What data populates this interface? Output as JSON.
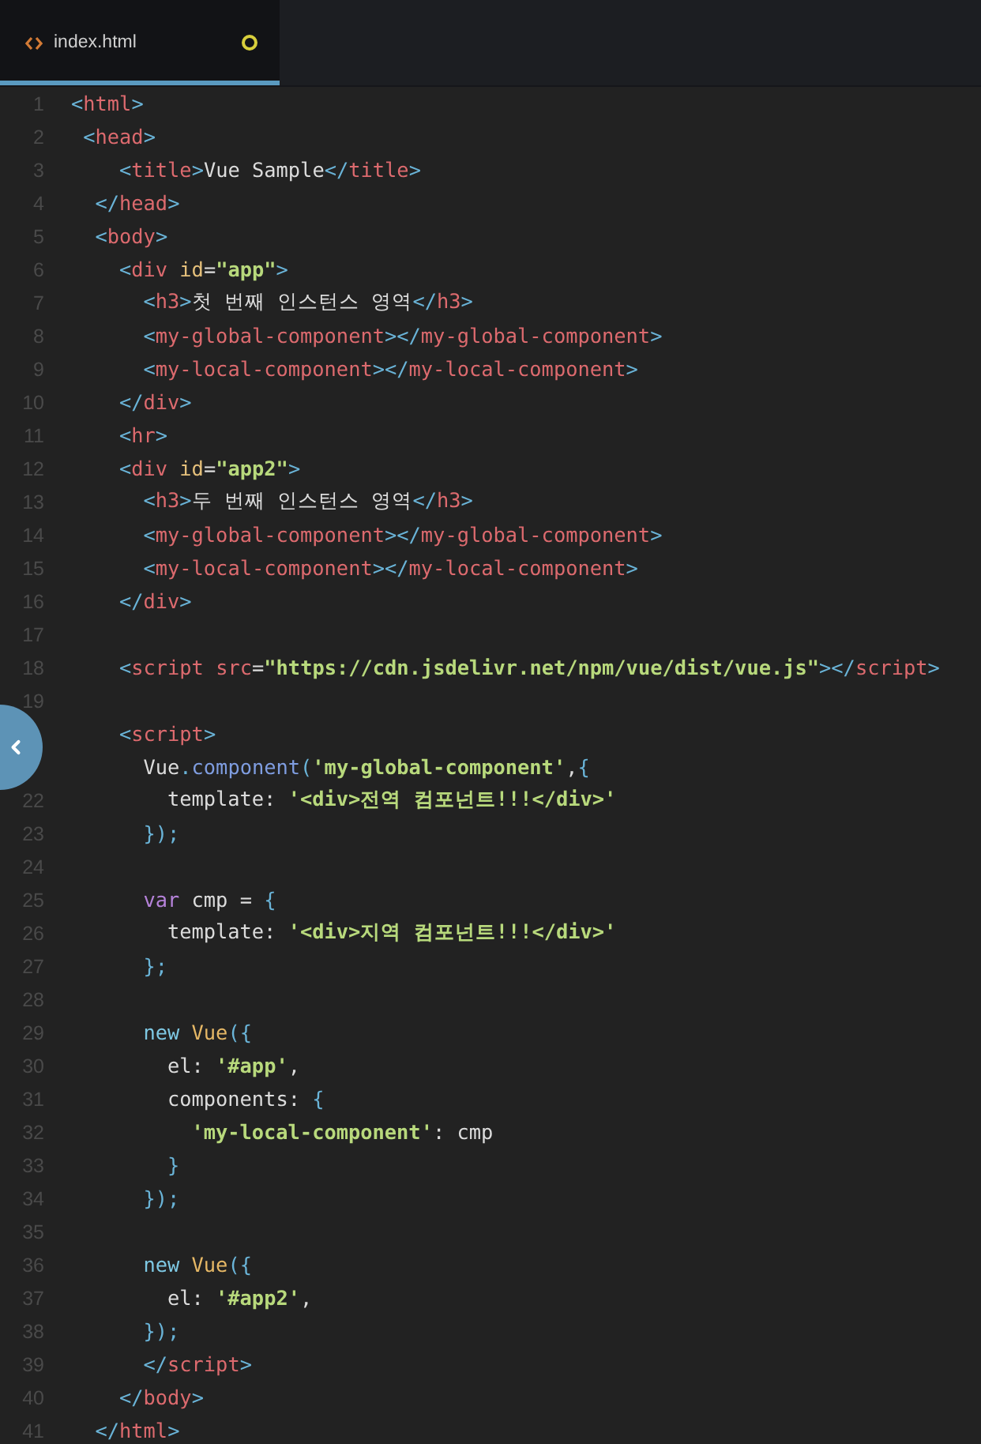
{
  "tabs": [
    {
      "label": "index.html",
      "selected": true,
      "modified": true
    }
  ],
  "lines": [
    {
      "number": "1",
      "tokens": [
        {
          "kind": "bracket",
          "text": "<"
        },
        {
          "kind": "tag",
          "text": "html"
        },
        {
          "kind": "bracket",
          "text": ">"
        }
      ]
    },
    {
      "number": "2",
      "tokens": [
        {
          "kind": "bracket",
          "text": " <"
        },
        {
          "kind": "tag",
          "text": "head"
        },
        {
          "kind": "bracket",
          "text": ">"
        }
      ]
    },
    {
      "number": "3",
      "tokens": [
        {
          "kind": "bracket",
          "text": "    <"
        },
        {
          "kind": "tag",
          "text": "title"
        },
        {
          "kind": "bracket",
          "text": ">"
        },
        {
          "kind": "text",
          "text": "Vue Sample"
        },
        {
          "kind": "bracket",
          "text": "</"
        },
        {
          "kind": "tag",
          "text": "title"
        },
        {
          "kind": "bracket",
          "text": ">"
        }
      ]
    },
    {
      "number": "4",
      "tokens": [
        {
          "kind": "bracket",
          "text": "  </"
        },
        {
          "kind": "tag",
          "text": "head"
        },
        {
          "kind": "bracket",
          "text": ">"
        }
      ]
    },
    {
      "number": "5",
      "tokens": [
        {
          "kind": "bracket",
          "text": "  <"
        },
        {
          "kind": "tag",
          "text": "body"
        },
        {
          "kind": "bracket",
          "text": ">"
        }
      ]
    },
    {
      "number": "6",
      "tokens": [
        {
          "kind": "bracket",
          "text": "    <"
        },
        {
          "kind": "tag",
          "text": "div"
        },
        {
          "kind": "attr",
          "text": " id"
        },
        {
          "kind": "text",
          "text": "="
        },
        {
          "kind": "string",
          "text": "\"app\""
        },
        {
          "kind": "bracket",
          "text": ">"
        }
      ]
    },
    {
      "number": "7",
      "tokens": [
        {
          "kind": "bracket",
          "text": "      <"
        },
        {
          "kind": "tag",
          "text": "h3"
        },
        {
          "kind": "bracket",
          "text": ">"
        },
        {
          "kind": "text",
          "text": "첫 번째 인스턴스 영역"
        },
        {
          "kind": "bracket",
          "text": "</"
        },
        {
          "kind": "tag",
          "text": "h3"
        },
        {
          "kind": "bracket",
          "text": ">"
        }
      ]
    },
    {
      "number": "8",
      "tokens": [
        {
          "kind": "bracket",
          "text": "      <"
        },
        {
          "kind": "tag",
          "text": "my-global-component"
        },
        {
          "kind": "bracket",
          "text": "></"
        },
        {
          "kind": "tag",
          "text": "my-global-component"
        },
        {
          "kind": "bracket",
          "text": ">"
        }
      ]
    },
    {
      "number": "9",
      "tokens": [
        {
          "kind": "bracket",
          "text": "      <"
        },
        {
          "kind": "tag",
          "text": "my-local-component"
        },
        {
          "kind": "bracket",
          "text": "></"
        },
        {
          "kind": "tag",
          "text": "my-local-component"
        },
        {
          "kind": "bracket",
          "text": ">"
        }
      ]
    },
    {
      "number": "10",
      "tokens": [
        {
          "kind": "bracket",
          "text": "    </"
        },
        {
          "kind": "tag",
          "text": "div"
        },
        {
          "kind": "bracket",
          "text": ">"
        }
      ]
    },
    {
      "number": "11",
      "tokens": [
        {
          "kind": "bracket",
          "text": "    <"
        },
        {
          "kind": "tag",
          "text": "hr"
        },
        {
          "kind": "bracket",
          "text": ">"
        }
      ]
    },
    {
      "number": "12",
      "tokens": [
        {
          "kind": "bracket",
          "text": "    <"
        },
        {
          "kind": "tag",
          "text": "div"
        },
        {
          "kind": "attr",
          "text": " id"
        },
        {
          "kind": "text",
          "text": "="
        },
        {
          "kind": "string",
          "text": "\"app2\""
        },
        {
          "kind": "bracket",
          "text": ">"
        }
      ]
    },
    {
      "number": "13",
      "tokens": [
        {
          "kind": "bracket",
          "text": "      <"
        },
        {
          "kind": "tag",
          "text": "h3"
        },
        {
          "kind": "bracket",
          "text": ">"
        },
        {
          "kind": "text",
          "text": "두 번째 인스턴스 영역"
        },
        {
          "kind": "bracket",
          "text": "</"
        },
        {
          "kind": "tag",
          "text": "h3"
        },
        {
          "kind": "bracket",
          "text": ">"
        }
      ]
    },
    {
      "number": "14",
      "tokens": [
        {
          "kind": "bracket",
          "text": "      <"
        },
        {
          "kind": "tag",
          "text": "my-global-component"
        },
        {
          "kind": "bracket",
          "text": "></"
        },
        {
          "kind": "tag",
          "text": "my-global-component"
        },
        {
          "kind": "bracket",
          "text": ">"
        }
      ]
    },
    {
      "number": "15",
      "tokens": [
        {
          "kind": "bracket",
          "text": "      <"
        },
        {
          "kind": "tag",
          "text": "my-local-component"
        },
        {
          "kind": "bracket",
          "text": "></"
        },
        {
          "kind": "tag",
          "text": "my-local-component"
        },
        {
          "kind": "bracket",
          "text": ">"
        }
      ]
    },
    {
      "number": "16",
      "tokens": [
        {
          "kind": "bracket",
          "text": "    </"
        },
        {
          "kind": "tag",
          "text": "div"
        },
        {
          "kind": "bracket",
          "text": ">"
        }
      ]
    },
    {
      "number": "17"
    },
    {
      "number": "18",
      "tokens": [
        {
          "kind": "bracket",
          "text": "    <"
        },
        {
          "kind": "tag",
          "text": "script"
        },
        {
          "kind": "tag",
          "text": " src"
        },
        {
          "kind": "text",
          "text": "="
        },
        {
          "kind": "string",
          "text": "\"https://cdn.jsdelivr.net/npm/vue/dist/vue.js\""
        },
        {
          "kind": "bracket",
          "text": "></"
        },
        {
          "kind": "tag",
          "text": "script"
        },
        {
          "kind": "bracket",
          "text": ">"
        }
      ]
    },
    {
      "number": "19"
    },
    {
      "tokens": [
        {
          "kind": "bracket",
          "text": "    <"
        },
        {
          "kind": "tag",
          "text": "script"
        },
        {
          "kind": "bracket",
          "text": ">"
        }
      ]
    },
    {
      "tokens": [
        {
          "kind": "text",
          "text": "      Vue"
        },
        {
          "kind": "punct",
          "text": "."
        },
        {
          "kind": "method",
          "text": "component"
        },
        {
          "kind": "punct",
          "text": "("
        },
        {
          "kind": "string",
          "text": "'my-global-component'"
        },
        {
          "kind": "text",
          "text": ","
        },
        {
          "kind": "punct",
          "text": "{"
        }
      ]
    },
    {
      "number": "22",
      "tokens": [
        {
          "kind": "text",
          "text": "        template: "
        },
        {
          "kind": "string",
          "text": "'<div>전역 컴포넌트!!!</div>'"
        }
      ]
    },
    {
      "number": "23",
      "tokens": [
        {
          "kind": "punct",
          "text": "      });"
        }
      ]
    },
    {
      "number": "24"
    },
    {
      "number": "25",
      "tokens": [
        {
          "kind": "keyword",
          "text": "      var"
        },
        {
          "kind": "text",
          "text": " cmp = "
        },
        {
          "kind": "punct",
          "text": "{"
        }
      ]
    },
    {
      "number": "26",
      "tokens": [
        {
          "kind": "text",
          "text": "        template: "
        },
        {
          "kind": "string",
          "text": "'<div>지역 컴포넌트!!!</div>'"
        }
      ]
    },
    {
      "number": "27",
      "tokens": [
        {
          "kind": "punct",
          "text": "      };"
        }
      ]
    },
    {
      "number": "28"
    },
    {
      "number": "29",
      "tokens": [
        {
          "kind": "operator",
          "text": "      new "
        },
        {
          "kind": "class",
          "text": "Vue"
        },
        {
          "kind": "punct",
          "text": "({"
        }
      ]
    },
    {
      "number": "30",
      "tokens": [
        {
          "kind": "text",
          "text": "        el: "
        },
        {
          "kind": "string",
          "text": "'#app'"
        },
        {
          "kind": "text",
          "text": ","
        }
      ]
    },
    {
      "number": "31",
      "tokens": [
        {
          "kind": "text",
          "text": "        components: "
        },
        {
          "kind": "punct",
          "text": "{"
        }
      ]
    },
    {
      "number": "32",
      "tokens": [
        {
          "kind": "string",
          "text": "          'my-local-component'"
        },
        {
          "kind": "text",
          "text": ": cmp"
        }
      ]
    },
    {
      "number": "33",
      "tokens": [
        {
          "kind": "punct",
          "text": "        }"
        }
      ]
    },
    {
      "number": "34",
      "tokens": [
        {
          "kind": "punct",
          "text": "      });"
        }
      ]
    },
    {
      "number": "35"
    },
    {
      "number": "36",
      "tokens": [
        {
          "kind": "operator",
          "text": "      new "
        },
        {
          "kind": "class",
          "text": "Vue"
        },
        {
          "kind": "punct",
          "text": "({"
        }
      ]
    },
    {
      "number": "37",
      "tokens": [
        {
          "kind": "text",
          "text": "        el: "
        },
        {
          "kind": "string",
          "text": "'#app2'"
        },
        {
          "kind": "text",
          "text": ","
        }
      ]
    },
    {
      "number": "38",
      "tokens": [
        {
          "kind": "punct",
          "text": "      });"
        }
      ]
    },
    {
      "number": "39",
      "tokens": [
        {
          "kind": "bracket",
          "text": "      </"
        },
        {
          "kind": "tag",
          "text": "script"
        },
        {
          "kind": "bracket",
          "text": ">"
        }
      ]
    },
    {
      "number": "40",
      "tokens": [
        {
          "kind": "bracket",
          "text": "    </"
        },
        {
          "kind": "tag",
          "text": "body"
        },
        {
          "kind": "bracket",
          "text": ">"
        }
      ]
    },
    {
      "number": "41",
      "tokens": [
        {
          "kind": "bracket",
          "text": "  </"
        },
        {
          "kind": "tag",
          "text": "html"
        },
        {
          "kind": "bracket",
          "text": ">"
        }
      ]
    }
  ]
}
